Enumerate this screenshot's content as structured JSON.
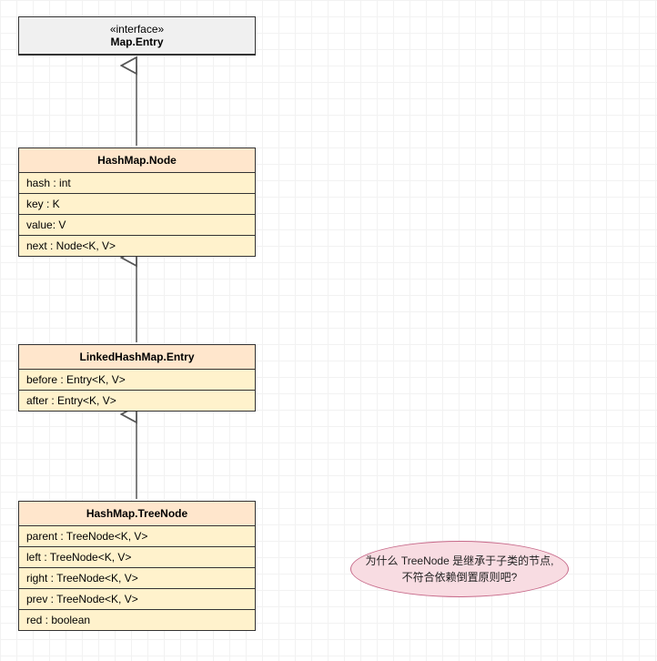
{
  "interface": {
    "stereotype": "«interface»",
    "name": "Map.Entry"
  },
  "node": {
    "name": "HashMap.Node",
    "attrs": [
      "hash : int",
      "key : K",
      "value: V",
      "next : Node<K, V>"
    ]
  },
  "entry": {
    "name": "LinkedHashMap.Entry",
    "attrs": [
      "before : Entry<K, V>",
      "after : Entry<K, V>"
    ]
  },
  "treenode": {
    "name": "HashMap.TreeNode",
    "attrs": [
      "parent : TreeNode<K, V>",
      "left : TreeNode<K, V>",
      "right : TreeNode<K, V>",
      "prev : TreeNode<K, V>",
      "red : boolean"
    ]
  },
  "note": {
    "line1": "为什么 TreeNode 是继承于子类的节点,",
    "line2": "不符合依赖倒置原则吧?"
  }
}
